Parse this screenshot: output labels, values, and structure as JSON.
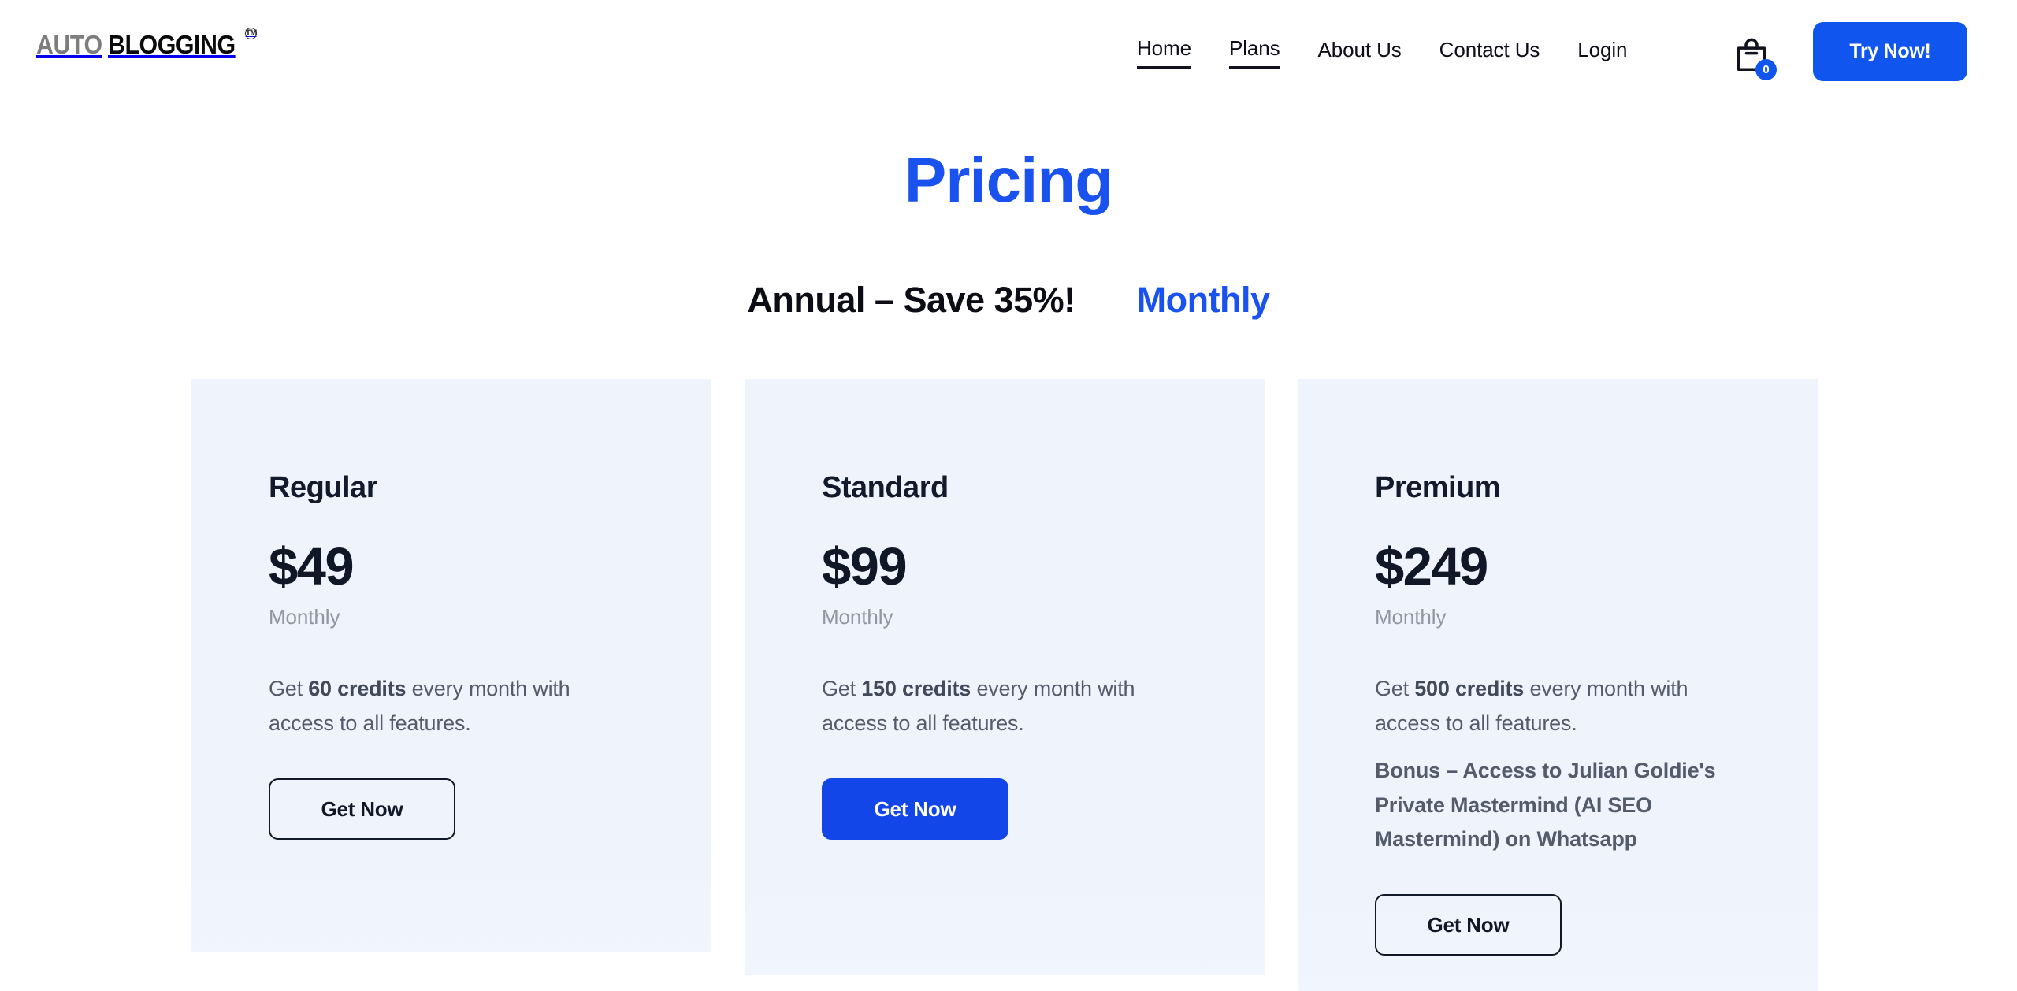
{
  "brand": {
    "logo_part1": "AUTO",
    "logo_part2": "BLOGGING",
    "logo_tm": "TM"
  },
  "header": {
    "nav": [
      {
        "label": "Home",
        "active": true
      },
      {
        "label": "Plans",
        "active": true
      },
      {
        "label": "About Us",
        "active": false
      },
      {
        "label": "Contact Us",
        "active": false
      },
      {
        "label": "Login",
        "active": false
      }
    ],
    "cart": {
      "icon": "shopping-bag-icon",
      "count": "0"
    },
    "cta_label": "Try Now!"
  },
  "page": {
    "title": "Pricing"
  },
  "billing_toggle": {
    "annual_label": "Annual – Save 35%!",
    "monthly_label": "Monthly",
    "selected": "Monthly"
  },
  "plans": [
    {
      "name": "Regular",
      "price": "$49",
      "period": "Monthly",
      "desc_pre": "Get ",
      "desc_bold": "60 credits",
      "desc_post": " every month with access to all features.",
      "bonus": "",
      "cta_label": "Get Now",
      "cta_style": "outline"
    },
    {
      "name": "Standard",
      "price": "$99",
      "period": "Monthly",
      "desc_pre": "Get ",
      "desc_bold": "150 credits",
      "desc_post": " every month with access to all features.",
      "bonus": "",
      "cta_label": "Get Now",
      "cta_style": "filled"
    },
    {
      "name": "Premium",
      "price": "$249",
      "period": "Monthly",
      "desc_pre": "Get ",
      "desc_bold": "500 credits",
      "desc_post": " every month with access to all features.",
      "bonus": "Bonus – Access to Julian Goldie's Private Mastermind (AI SEO Mastermind) on Whatsapp",
      "cta_label": "Get Now",
      "cta_style": "outline"
    }
  ],
  "colors": {
    "accent_blue": "#1155ef",
    "title_blue": "#1a52f0",
    "card_bg": "#eef3fc",
    "text_dark": "#101828",
    "text_muted": "#9096a2"
  }
}
